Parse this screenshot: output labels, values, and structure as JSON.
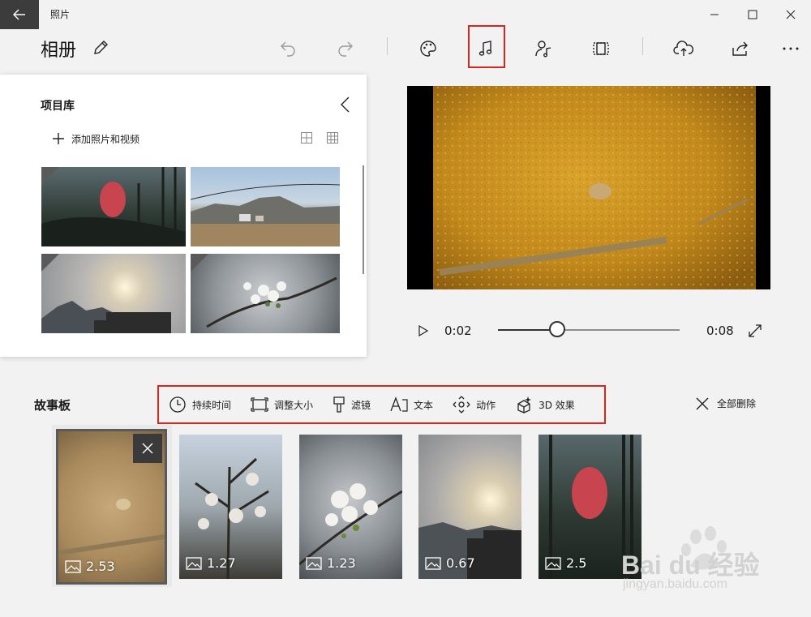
{
  "window": {
    "title": "照片"
  },
  "header": {
    "album_title": "相册"
  },
  "library": {
    "title": "项目库",
    "add_label": "添加照片和视频"
  },
  "player": {
    "current_time": "0:02",
    "end_time": "0:08",
    "progress": 0.325
  },
  "storyboard": {
    "title": "故事板",
    "tools": [
      {
        "label": "持续时间",
        "icon": "clock-icon"
      },
      {
        "label": "调整大小",
        "icon": "resize-icon"
      },
      {
        "label": "滤镜",
        "icon": "filter-icon"
      },
      {
        "label": "文本",
        "icon": "text-icon"
      },
      {
        "label": "动作",
        "icon": "motion-icon"
      },
      {
        "label": "3D 效果",
        "icon": "3d-effects-icon"
      }
    ],
    "delete_all": "全部删除",
    "cards": [
      {
        "duration": "2.53"
      },
      {
        "duration": "1.27"
      },
      {
        "duration": "1.23"
      },
      {
        "duration": "0.67"
      },
      {
        "duration": "2.5"
      }
    ]
  },
  "watermark": {
    "brand": "Bai du 经验",
    "url": "jingyan.baidu.com"
  },
  "colors": {
    "highlight": "#d9261c",
    "back_button_bg": "#3c3c3c"
  }
}
